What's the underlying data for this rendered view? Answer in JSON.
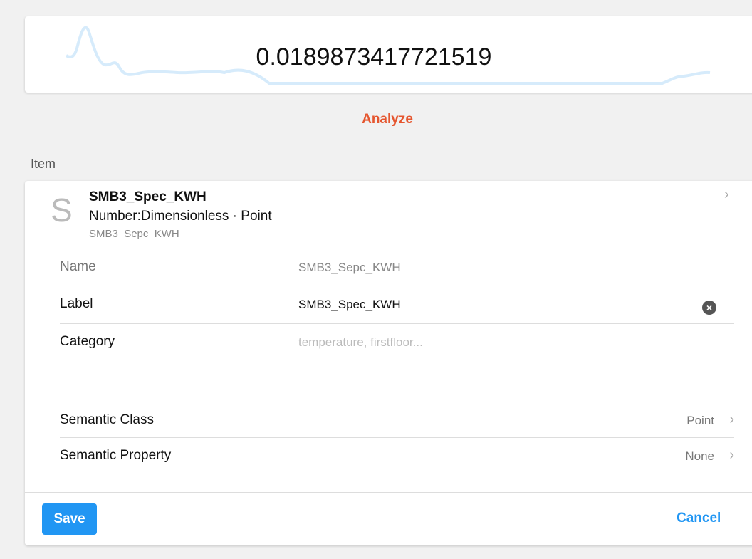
{
  "state_card": {
    "value": "0.0189873417721519",
    "sparkline_color": "#d6ebfb"
  },
  "analyze_label": "Analyze",
  "section_title": "Item",
  "item": {
    "avatar_letter": "S",
    "label": "SMB3_Spec_KWH",
    "type": "Number:Dimensionless · Point",
    "name": "SMB3_Sepc_KWH"
  },
  "fields": {
    "name_label": "Name",
    "name_value": "SMB3_Sepc_KWH",
    "label_label": "Label",
    "label_value": "SMB3_Spec_KWH",
    "category_label": "Category",
    "category_placeholder": "temperature, firstfloor...",
    "semantic_class_label": "Semantic Class",
    "semantic_class_value": "Point",
    "semantic_property_label": "Semantic Property",
    "semantic_property_value": "None"
  },
  "buttons": {
    "save": "Save",
    "cancel": "Cancel"
  }
}
